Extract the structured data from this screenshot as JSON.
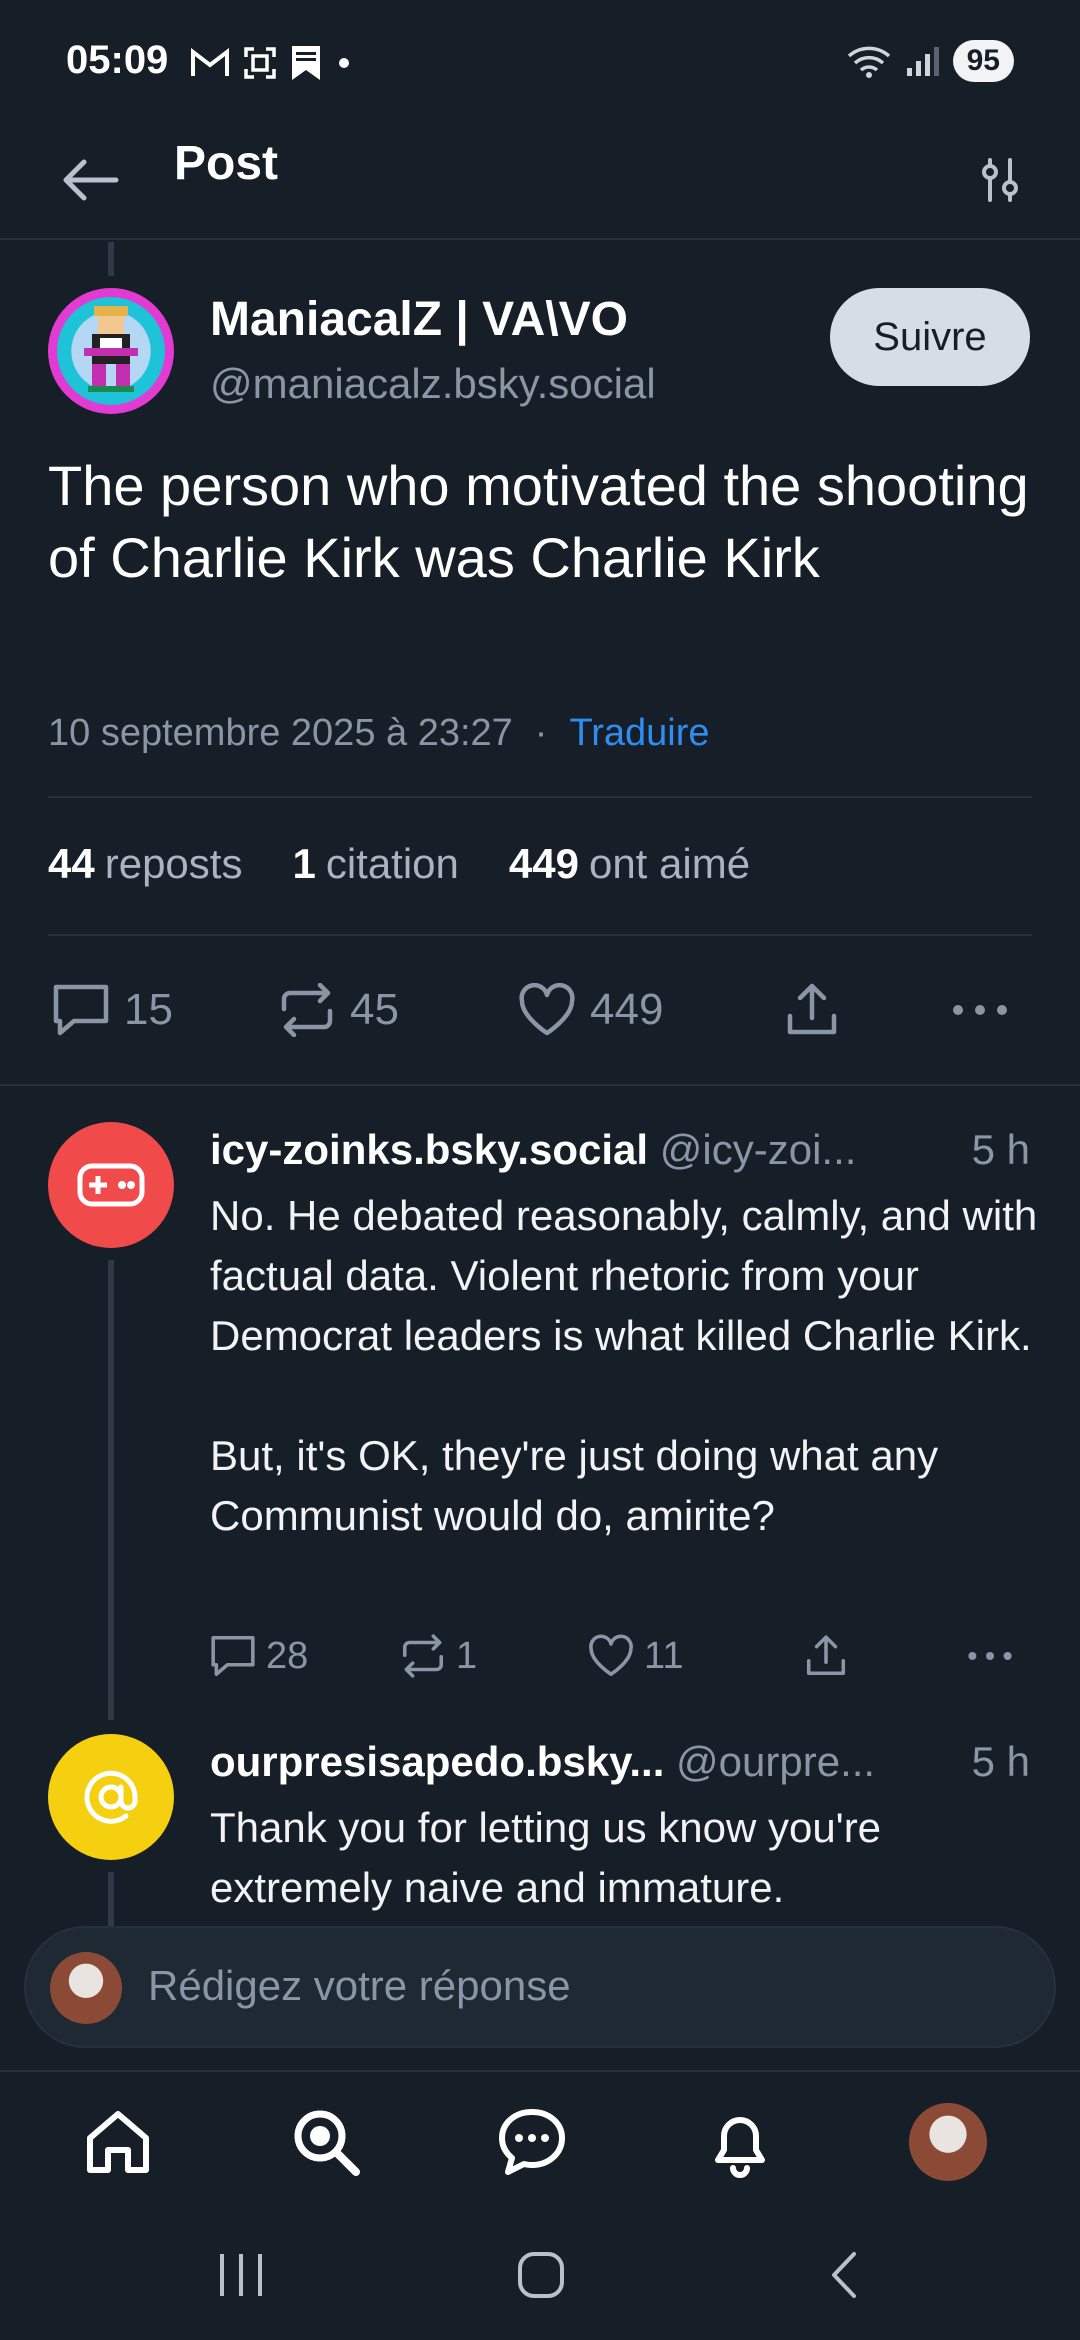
{
  "status_bar": {
    "time": "05:09",
    "battery": "95",
    "left_icons": [
      "gmail-icon",
      "screenshot-icon",
      "bookmark-icon",
      "dot-icon"
    ],
    "right_icons": [
      "wifi-icon",
      "signal-icon"
    ]
  },
  "header": {
    "title": "Post",
    "back_icon": "arrow-left-icon",
    "filter_icon": "sliders-icon"
  },
  "post": {
    "author_name": "ManiacalZ | VA\\VO",
    "author_handle": "@maniacalz.bsky.social",
    "follow_label": "Suivre",
    "text": "The person who motivated the shooting of Charlie Kirk was Charlie Kirk",
    "date": "10 septembre 2025 à 23:27",
    "separator": "·",
    "translate_label": "Traduire",
    "stats": {
      "reposts_count": "44",
      "reposts_label": "reposts",
      "quotes_count": "1",
      "quotes_label": "citation",
      "likes_count": "449",
      "likes_label": "ont aimé"
    },
    "actions": {
      "replies": "15",
      "reposts": "45",
      "likes": "449"
    }
  },
  "replies": [
    {
      "name": "icy-zoinks.bsky.social",
      "handle": "@icy-zoi...",
      "time": "5 h",
      "avatar_color": "#f04a4a",
      "avatar_icon": "gamepad-icon",
      "text": "No. He debated reasonably, calmly, and with factual data. Violent rhetoric from your Democrat leaders is what killed Charlie Kirk.\n\nBut, it's OK, they're just doing what any Communist would do, amirite?",
      "replies": "28",
      "reposts": "1",
      "likes": "11"
    },
    {
      "name": "ourpresisapedo.bsky...",
      "handle": "@ourpre...",
      "time": "5 h",
      "avatar_color": "#f5d010",
      "avatar_icon": "at-icon",
      "text": "Thank you for letting us know you're extremely naive and immature."
    }
  ],
  "composer": {
    "placeholder": "Rédigez votre réponse"
  },
  "bottom_nav": [
    "home-icon",
    "search-icon",
    "chat-icon",
    "bell-icon",
    "profile-avatar"
  ],
  "colors": {
    "background": "#161e27",
    "accent": "#2f8cf0",
    "muted": "#8a96a5"
  }
}
